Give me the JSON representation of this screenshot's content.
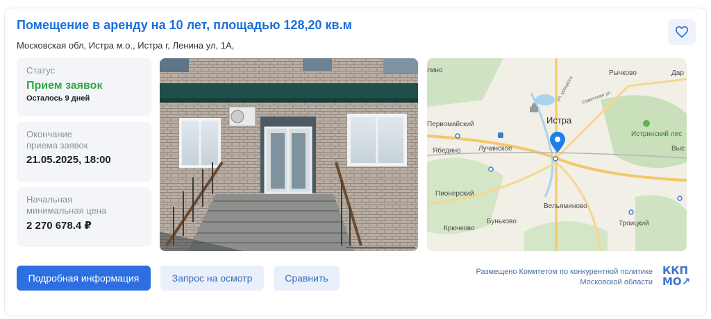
{
  "listing": {
    "title": "Помещение в аренду на 10 лет, площадью 128,20 кв.м",
    "address": "Московская обл, Истра м.о., Истра г, Ленина ул, 1А,",
    "favorite_icon": "heart-icon"
  },
  "status": {
    "label": "Статус",
    "value": "Прием заявок",
    "remaining": "Осталось 9 дней",
    "color": "#36a843"
  },
  "deadline": {
    "label_line1": "Окончание",
    "label_line2": "приема заявок",
    "value": "21.05.2025, 18:00"
  },
  "price": {
    "label_line1": "Начальная",
    "label_line2": "минимальная цена",
    "value": "2 270 678.4 ₽"
  },
  "map": {
    "labels": {
      "ilino": "лино",
      "rychkovo": "Рычково",
      "dar": "Дар",
      "pervomaysky": "Первомайский",
      "istra": "Истра",
      "istra_forest": "Истринский лес",
      "yabedino": "Ябедино",
      "luchinskoe": "Лучинское",
      "vys": "Выс",
      "pionersky": "Пионерский",
      "velyaminovo": "Вельяминово",
      "bunkovo": "Бунько­во",
      "troitsky": "Троицкий",
      "kryuchkovo": "Крючково",
      "street1": "ул. урицкого",
      "street2": "Советская ул."
    }
  },
  "actions": {
    "details": "Подробная информация",
    "inspection": "Запрос на осмотр",
    "compare": "Сравнить"
  },
  "publisher": {
    "line1": "Размещено Комитетом по конкурентной политике",
    "line2": "Московской области",
    "logo_line1": "ККП",
    "logo_line2": "МО↗"
  },
  "colors": {
    "accent": "#1a6fdc",
    "primary_button": "#2d6fe0",
    "secondary_button": "#e9f0fb"
  }
}
